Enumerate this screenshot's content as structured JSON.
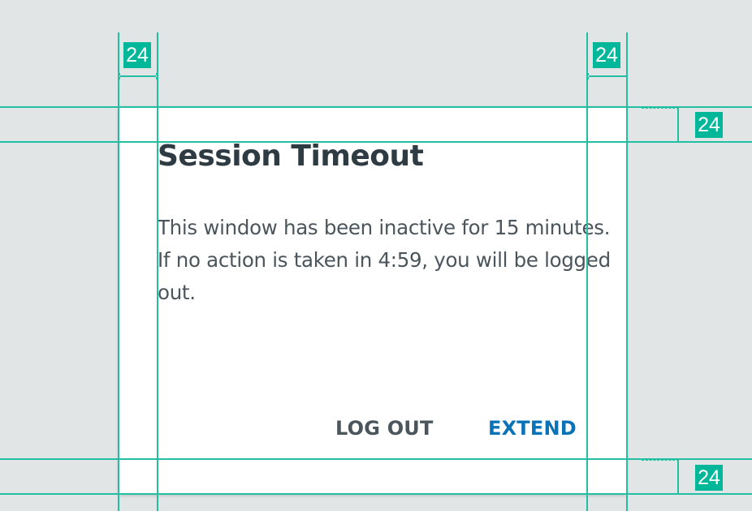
{
  "dialog": {
    "title": "Session Timeout",
    "message": "This window has been inactive for 15 minutes. If no action is taken in 4:59, you will be logged out.",
    "actions": {
      "logout_label": "LOG OUT",
      "extend_label": "EXTEND"
    }
  },
  "annotations": {
    "spacing_left": "24",
    "spacing_right": "24",
    "spacing_top": "24",
    "spacing_bottom": "24"
  },
  "colors": {
    "background": "#e2e5e6",
    "dialog": "#ffffff",
    "guide": "#22bfa3",
    "badge": "#00b899",
    "primary_action": "#0a73b8",
    "secondary_action": "#4a555c",
    "title": "#2f3b43"
  }
}
